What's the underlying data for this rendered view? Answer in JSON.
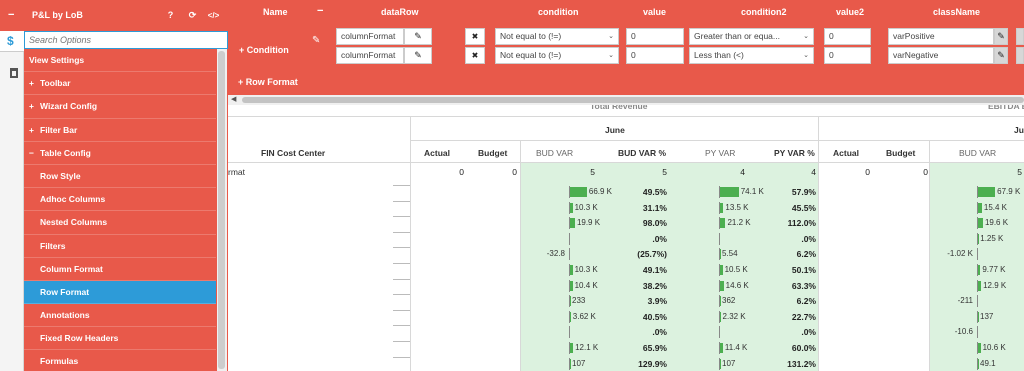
{
  "sidebar": {
    "title": "P&L by LoB",
    "collapse_glyph": "−",
    "help_glyph": "?",
    "refresh_glyph": "⟳",
    "code_glyph": "</>",
    "search_placeholder": "Search Options",
    "strip_tab_glyph": "$",
    "items": [
      {
        "label": "View Settings",
        "level": 0,
        "prefix": ""
      },
      {
        "label": "Toolbar",
        "level": 0,
        "prefix": "+"
      },
      {
        "label": "Wizard Config",
        "level": 0,
        "prefix": "+"
      },
      {
        "label": "Filter Bar",
        "level": 0,
        "prefix": "+"
      },
      {
        "label": "Table Config",
        "level": 0,
        "prefix": "−"
      },
      {
        "label": "Row Style",
        "level": 1,
        "prefix": ""
      },
      {
        "label": "Adhoc Columns",
        "level": 1,
        "prefix": ""
      },
      {
        "label": "Nested Columns",
        "level": 1,
        "prefix": ""
      },
      {
        "label": "Filters",
        "level": 1,
        "prefix": ""
      },
      {
        "label": "Column Format",
        "level": 1,
        "prefix": ""
      },
      {
        "label": "Row Format",
        "level": 1,
        "prefix": "",
        "active": true
      },
      {
        "label": "Annotations",
        "level": 1,
        "prefix": ""
      },
      {
        "label": "Fixed Row Headers",
        "level": 1,
        "prefix": ""
      },
      {
        "label": "Formulas",
        "level": 1,
        "prefix": ""
      }
    ]
  },
  "rowformat": {
    "headers": {
      "name": "Name",
      "dataRow": "dataRow",
      "condition": "condition",
      "value": "value",
      "condition2": "condition2",
      "value2": "value2",
      "className": "className"
    },
    "minus_glyph": "−",
    "condition_label": "+ Condition",
    "add_row_format_label": "+ Row Format",
    "edit_glyph": "✎",
    "delete_glyph": "✖",
    "rows": [
      {
        "dataRow": "columnFormat",
        "condition": "Not equal to (!=)",
        "value": "0",
        "condition2": "Greater than or equa...",
        "value2": "0",
        "className": "varPositive"
      },
      {
        "dataRow": "columnFormat",
        "condition": "Not equal to (!=)",
        "value": "0",
        "condition2": "Less than (<)",
        "value2": "0",
        "className": "varNegative"
      }
    ]
  },
  "table": {
    "group_left": "Total Revenue",
    "group_right": "EBITDA Before",
    "month_left": "June",
    "month_right": "Ju",
    "row_header": "FIN Cost Center",
    "columns_left": [
      "Actual",
      "Budget",
      "BUD VAR",
      "BUD VAR %",
      "PY VAR",
      "PY VAR %"
    ],
    "columns_right": [
      "Actual",
      "Budget",
      "BUD VAR"
    ],
    "first_row_label": "rmat",
    "first_row": {
      "actual": "0",
      "budget": "0",
      "bud_var": "5",
      "bud_var_pct": "5",
      "py_var": "4",
      "py_var_pct": "4",
      "actual2": "0",
      "budget2": "0",
      "bud_var2": "5"
    },
    "rows": [
      {
        "bud_var": "66.9 K",
        "bud_pct": "49.5%",
        "py_var": "74.1 K",
        "py_pct": "57.9%",
        "bud_var2": "67.9 K",
        "b1": 0.65,
        "b2": 0.72,
        "b3": 0.66
      },
      {
        "bud_var": "10.3 K",
        "bud_pct": "31.1%",
        "py_var": "13.5 K",
        "py_pct": "45.5%",
        "bud_var2": "15.4 K",
        "b1": 0.1,
        "b2": 0.13,
        "b3": 0.15
      },
      {
        "bud_var": "19.9 K",
        "bud_pct": "98.0%",
        "py_var": "21.2 K",
        "py_pct": "112.0%",
        "bud_var2": "19.6 K",
        "b1": 0.19,
        "b2": 0.21,
        "b3": 0.19
      },
      {
        "bud_var": "",
        "bud_pct": ".0%",
        "py_var": "",
        "py_pct": ".0%",
        "bud_var2": "1.25 K",
        "b1": 0,
        "b2": 0,
        "b3": 0.01
      },
      {
        "bud_var": "-32.8",
        "bud_pct": "(25.7%)",
        "py_var": "5.54",
        "py_pct": "6.2%",
        "bud_var2": "-1.02 K",
        "b1": 0,
        "b2": 0,
        "b3": 0,
        "neg1": true,
        "neg3": true
      },
      {
        "bud_var": "10.3 K",
        "bud_pct": "49.1%",
        "py_var": "10.5 K",
        "py_pct": "50.1%",
        "bud_var2": "9.77 K",
        "b1": 0.1,
        "b2": 0.1,
        "b3": 0.09
      },
      {
        "bud_var": "10.4 K",
        "bud_pct": "38.2%",
        "py_var": "14.6 K",
        "py_pct": "63.3%",
        "bud_var2": "12.9 K",
        "b1": 0.1,
        "b2": 0.14,
        "b3": 0.12
      },
      {
        "bud_var": "233",
        "bud_pct": "3.9%",
        "py_var": "362",
        "py_pct": "6.2%",
        "bud_var2": "-211",
        "b1": 0,
        "b2": 0,
        "b3": 0,
        "neg3": true
      },
      {
        "bud_var": "3.62 K",
        "bud_pct": "40.5%",
        "py_var": "2.32 K",
        "py_pct": "22.7%",
        "bud_var2": "137",
        "b1": 0.03,
        "b2": 0.02,
        "b3": 0
      },
      {
        "bud_var": "",
        "bud_pct": ".0%",
        "py_var": "",
        "py_pct": ".0%",
        "bud_var2": "-10.6",
        "b1": 0,
        "b2": 0,
        "b3": 0,
        "neg3": true
      },
      {
        "bud_var": "12.1 K",
        "bud_pct": "65.9%",
        "py_var": "11.4 K",
        "py_pct": "60.0%",
        "bud_var2": "10.6 K",
        "b1": 0.12,
        "b2": 0.11,
        "b3": 0.1
      },
      {
        "bud_var": "107",
        "bud_pct": "129.9%",
        "py_var": "107",
        "py_pct": "131.2%",
        "bud_var2": "49.1",
        "b1": 0,
        "b2": 0,
        "b3": 0
      }
    ]
  }
}
